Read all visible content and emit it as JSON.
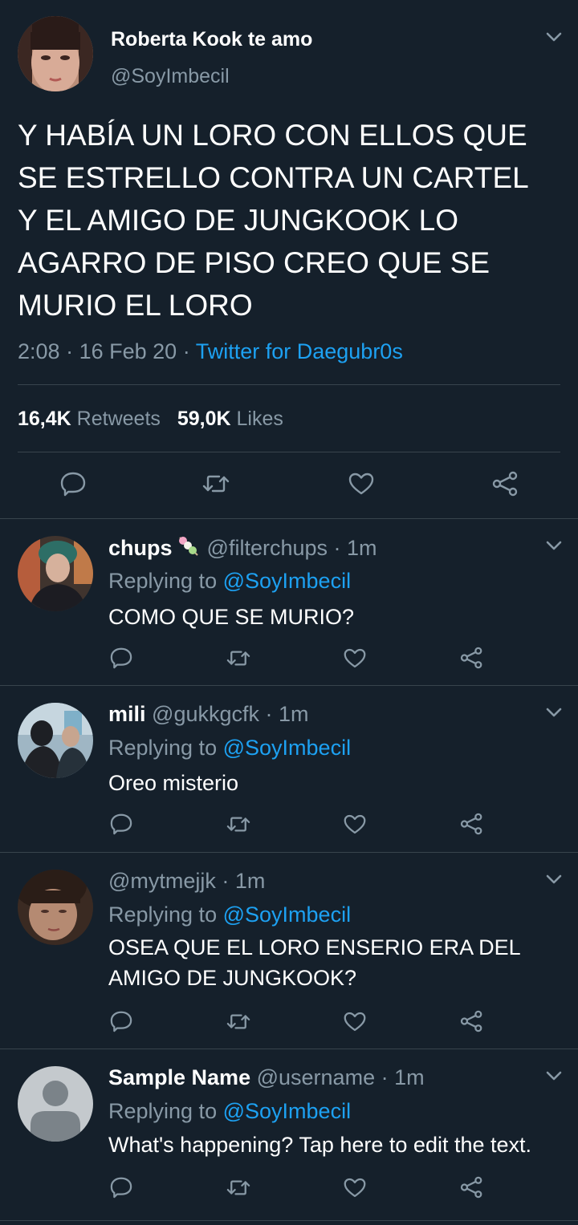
{
  "main_tweet": {
    "display_name": "Roberta Kook te amo",
    "handle": "@SoyImbecil",
    "text_lines": [
      "Y HABÍA UN LORO CON ELLOS QUE",
      "SE ESTRELLO CONTRA UN CARTEL",
      "Y EL AMIGO DE JUNGKOOK LO",
      "AGARRO DE PISO CREO QUE SE",
      "MURIO EL LORO"
    ],
    "time": "2:08",
    "date": "16 Feb 20",
    "separator": "·",
    "source": "Twitter for Daegubr0s",
    "retweets_count": "16,4K",
    "retweets_label": "Retweets",
    "likes_count": "59,0K",
    "likes_label": "Likes"
  },
  "replies": [
    {
      "display_name": "chups",
      "emoji_icon": "dango-icon",
      "handle": "@filterchups",
      "time": "· 1m",
      "replying_label": "Replying to",
      "replying_to": "@SoyImbecil",
      "text_lines": [
        "COMO QUE SE MURIO?"
      ]
    },
    {
      "display_name": "mili",
      "handle": "@gukkgcfk",
      "time": "· 1m",
      "replying_label": "Replying to",
      "replying_to": "@SoyImbecil",
      "text_lines": [
        "Oreo misterio"
      ]
    },
    {
      "display_name": "",
      "handle": "@mytmejjk",
      "time": "· 1m",
      "replying_label": "Replying to",
      "replying_to": "@SoyImbecil",
      "text_lines": [
        "OSEA QUE EL LORO ENSERIO ERA DEL",
        "AMIGO DE JUNGKOOK?"
      ]
    },
    {
      "display_name": "Sample Name",
      "handle": "@username",
      "time": "· 1m",
      "replying_label": "Replying to",
      "replying_to": "@SoyImbecil",
      "text_lines": [
        "What's happening? Tap here to edit the text."
      ]
    }
  ],
  "colors": {
    "background": "#15202b",
    "text": "#ffffff",
    "muted": "#8899a6",
    "link": "#1da1f2",
    "divider": "#38444d"
  }
}
